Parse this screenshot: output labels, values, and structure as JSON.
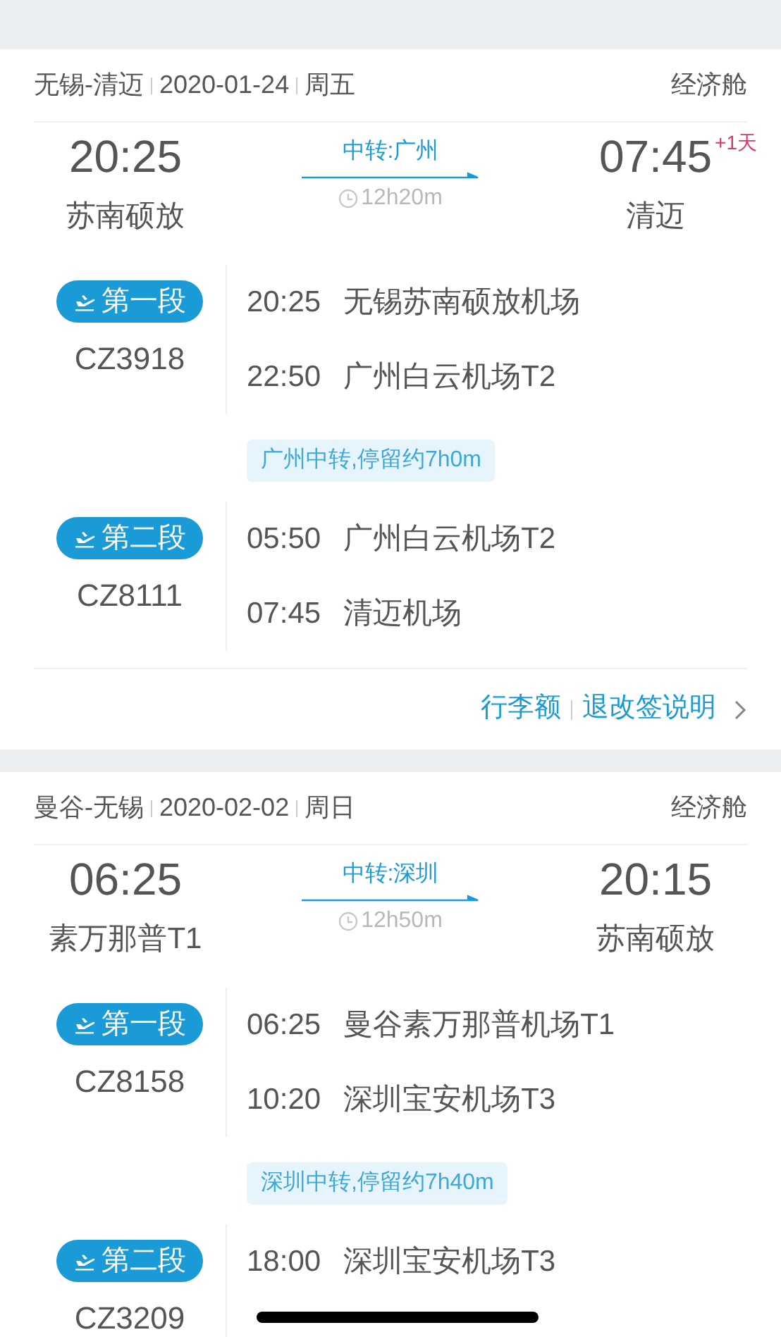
{
  "trips": [
    {
      "route": "无锡-清迈",
      "date": "2020-01-24",
      "weekday": "周五",
      "cabin": "经济舱",
      "depart": {
        "time": "20:25",
        "place": "苏南硕放"
      },
      "arrive": {
        "time": "07:45",
        "place": "清迈",
        "day_offset": "+1天"
      },
      "transfer": "中转:广州",
      "duration": "12h20m",
      "segments": [
        {
          "label": "第一段",
          "flight": "CZ3918",
          "stops": [
            {
              "time": "20:25",
              "airport": "无锡苏南硕放机场"
            },
            {
              "time": "22:50",
              "airport": "广州白云机场T2"
            }
          ]
        },
        {
          "label": "第二段",
          "flight": "CZ8111",
          "stops": [
            {
              "time": "05:50",
              "airport": "广州白云机场T2"
            },
            {
              "time": "07:45",
              "airport": "清迈机场"
            }
          ]
        }
      ],
      "layover": "广州中转,停留约7h0m",
      "links": [
        "行李额",
        "退改签说明"
      ]
    },
    {
      "route": "曼谷-无锡",
      "date": "2020-02-02",
      "weekday": "周日",
      "cabin": "经济舱",
      "depart": {
        "time": "06:25",
        "place": "素万那普T1"
      },
      "arrive": {
        "time": "20:15",
        "place": "苏南硕放"
      },
      "transfer": "中转:深圳",
      "duration": "12h50m",
      "segments": [
        {
          "label": "第一段",
          "flight": "CZ8158",
          "stops": [
            {
              "time": "06:25",
              "airport": "曼谷素万那普机场T1"
            },
            {
              "time": "10:20",
              "airport": "深圳宝安机场T3"
            }
          ]
        },
        {
          "label": "第二段",
          "flight": "CZ3209",
          "stops": [
            {
              "time": "18:00",
              "airport": "深圳宝安机场T3"
            }
          ]
        }
      ],
      "layover": "深圳中转,停留约7h40m"
    }
  ]
}
